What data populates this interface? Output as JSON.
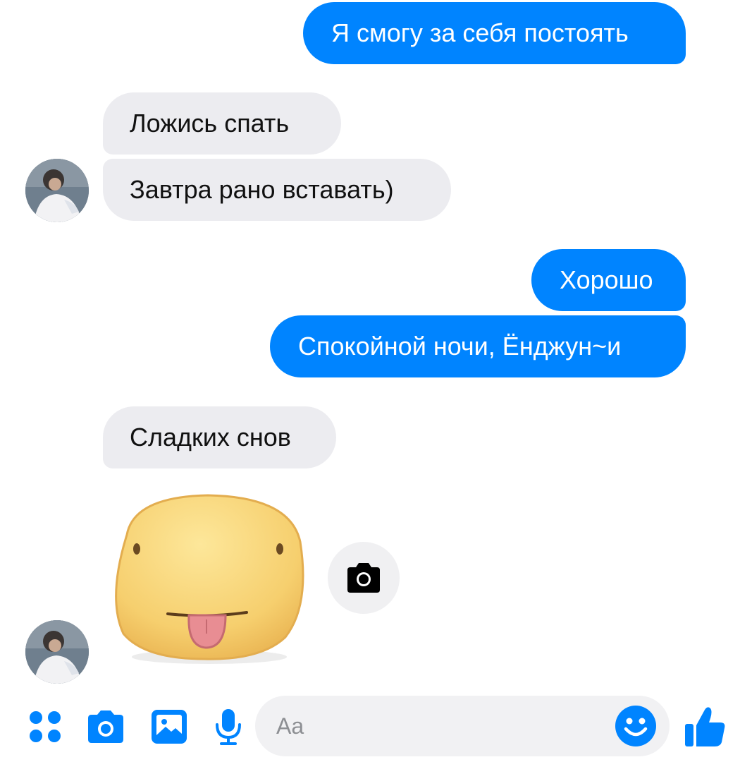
{
  "messages": {
    "m1": "Я смогу за себя постоять",
    "m2": "Ложись спать",
    "m3": "Завтра рано вставать)",
    "m4": "Хорошо",
    "m5": "Спокойной ночи, Ёнджун~и",
    "m6": "Сладких снов"
  },
  "composer": {
    "placeholder": "Aa"
  },
  "icons": {
    "apps": "apps-icon",
    "camera": "camera-icon",
    "gallery": "image-icon",
    "voice": "microphone-icon",
    "emoji": "emoji-icon",
    "like": "thumbs-up-icon",
    "sticker": "tongue-out-sticker",
    "sticker_camera": "camera-icon"
  },
  "colors": {
    "accent": "#0084ff",
    "incoming_bubble": "#ececf0",
    "outgoing_text": "#ffffff"
  }
}
